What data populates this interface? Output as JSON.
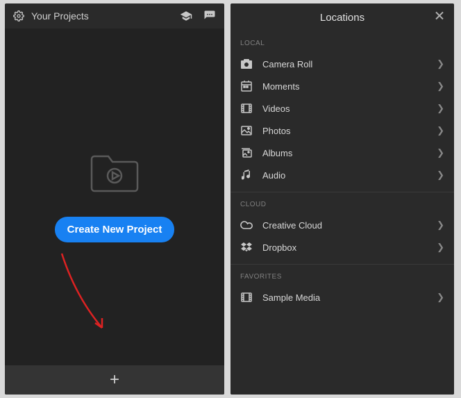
{
  "left": {
    "title": "Your Projects",
    "create_btn": "Create New Project",
    "plus": "+"
  },
  "right": {
    "title": "Locations",
    "sections": {
      "local": {
        "header": "LOCAL",
        "items": {
          "camera_roll": "Camera Roll",
          "moments": "Moments",
          "videos": "Videos",
          "photos": "Photos",
          "albums": "Albums",
          "audio": "Audio"
        }
      },
      "cloud": {
        "header": "CLOUD",
        "items": {
          "creative_cloud": "Creative Cloud",
          "dropbox": "Dropbox"
        }
      },
      "favorites": {
        "header": "FAVORITES",
        "items": {
          "sample_media": "Sample Media"
        }
      }
    }
  }
}
